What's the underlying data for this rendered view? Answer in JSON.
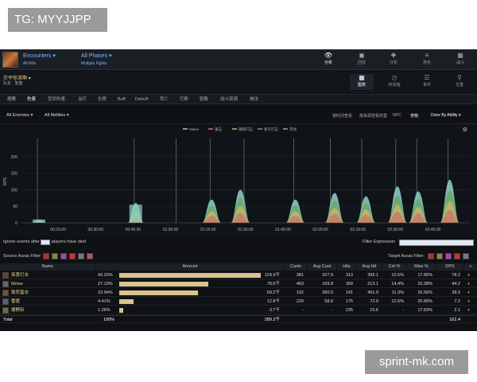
{
  "watermark_top": "TG: MYYJJPP",
  "watermark_bottom": "sprint-mk.com",
  "header": {
    "encounters_label": "Encounters ▾",
    "encounters_sub": "All Kills",
    "phases_label": "All Phases ▾",
    "phases_sub": "Multiple Fights",
    "nav": [
      {
        "label": "分析",
        "icon": "eye-icon",
        "glyph": "👁"
      },
      {
        "label": "回放",
        "icon": "replay-icon",
        "glyph": "▣"
      },
      {
        "label": "分析",
        "icon": "puzzle-icon",
        "glyph": "✚"
      },
      {
        "label": "排名",
        "icon": "bars-icon",
        "glyph": "≡"
      },
      {
        "label": "战斗",
        "icon": "fight-icon",
        "glyph": "▦"
      }
    ]
  },
  "subheader": {
    "player": "茫平你求啊 ▾",
    "player_sub": "队友 · 复盘",
    "views": [
      {
        "label": "图表",
        "glyph": "▦"
      },
      {
        "label": "时间轴",
        "glyph": "◷"
      },
      {
        "label": "事件",
        "glyph": "☰"
      },
      {
        "label": "位置",
        "glyph": "⚲"
      }
    ]
  },
  "tabs": [
    "摘要",
    "伤害",
    "受到伤害",
    "治疗",
    "仇恨",
    "Buff",
    "Debuff",
    "死亡",
    "打断",
    "驱散",
    "战斗资源",
    "施法"
  ],
  "filters": {
    "enemies": "All Enemies ▾",
    "abilities": "All Abilities ▾",
    "right": [
      "按时间查看",
      "按来源查看伤害",
      "NPC",
      "宠物",
      "Done By Ability ▾"
    ]
  },
  "chart_data": {
    "type": "area",
    "legend": [
      "Melee",
      "重击",
      "钢铁打击",
      "毁灭打击",
      "其他"
    ],
    "ylabel": "DPS",
    "yticks": [
      0,
      50,
      100,
      150,
      200
    ],
    "ylim": [
      0,
      250
    ],
    "xticks": [
      "00:15:00",
      "00:30:00",
      "00:45:00",
      "01:00:00",
      "01:15:00",
      "01:30:00",
      "01:45:00",
      "02:00:00",
      "02:15:00",
      "02:30:00",
      "02:45:00"
    ],
    "series": [
      {
        "name": "Melee",
        "color": "#8fd3c9"
      },
      {
        "name": "毁灭打击",
        "color": "#6aa86a"
      },
      {
        "name": "钢铁打击",
        "color": "#c4b56a"
      },
      {
        "name": "重击",
        "color": "#c97a6a"
      }
    ],
    "peaks": [
      {
        "t": 7,
        "v": 10
      },
      {
        "t": 44,
        "v": 60
      },
      {
        "t": 73,
        "v": 70
      },
      {
        "t": 84,
        "v": 100
      },
      {
        "t": 105,
        "v": 70
      },
      {
        "t": 120,
        "v": 90
      },
      {
        "t": 132,
        "v": 80
      },
      {
        "t": 144,
        "v": 110
      },
      {
        "t": 152,
        "v": 95
      },
      {
        "t": 164,
        "v": 130
      }
    ]
  },
  "ignore_text": "Ignore events after",
  "ignore_text2": "players have died",
  "filter_expression": "Filter Expression",
  "source_auras": "Source Auras Filter:",
  "target_auras": "Target Auras Filter:",
  "table": {
    "headers": [
      "Name",
      "Amount",
      "Casts",
      "Avg Cast",
      "Hits",
      "Avg Hit",
      "Crit %",
      "Miss %",
      "DPS",
      "+"
    ],
    "rows": [
      {
        "name": "英勇打击",
        "pct": "43.20%",
        "amt": "124.9千",
        "casts": "381",
        "avgcast": "327.9",
        "hits": "313",
        "avghit": "399.1",
        "crit": "10.5%",
        "miss": "17.85%",
        "dps": "78.2",
        "frac": 0.432,
        "color": "#7a3a2a"
      },
      {
        "name": "Melee",
        "pct": "27.19%",
        "amt": "78.6千",
        "casts": "463",
        "avgcast": "169.8",
        "hits": "369",
        "avghit": "213.1",
        "crit": "14.4%",
        "miss": "20.38%",
        "dps": "44.2",
        "frac": 0.2719,
        "color": "#666"
      },
      {
        "name": "致死猛击",
        "pct": "23.94%",
        "amt": "69.2千",
        "casts": "192",
        "avgcast": "360.5",
        "hits": "141",
        "avghit": "491.0",
        "crit": "11.3%",
        "miss": "26.56%",
        "dps": "38.9",
        "frac": 0.2394,
        "color": "#8a4a2a"
      },
      {
        "name": "雷霆",
        "pct": "4.41%",
        "amt": "12.8千",
        "casts": "220",
        "avgcast": "58.0",
        "hits": "175",
        "avghit": "72.9",
        "crit": "12.6%",
        "miss": "20.89%",
        "dps": "7.2",
        "frac": 0.0441,
        "color": "#5a5a8a"
      },
      {
        "name": "顺劈斩",
        "pct": "1.26%",
        "amt": "3.7千",
        "casts": "-",
        "avgcast": "-",
        "hits": "235",
        "avghit": "15.6",
        "crit": "-",
        "miss": "17.83%",
        "dps": "2.1",
        "frac": 0.0126,
        "color": "#7a6a3a"
      }
    ],
    "total_label": "Total",
    "total_pct": "100%",
    "total_amt": "289.2千",
    "total_dps": "162.4"
  }
}
